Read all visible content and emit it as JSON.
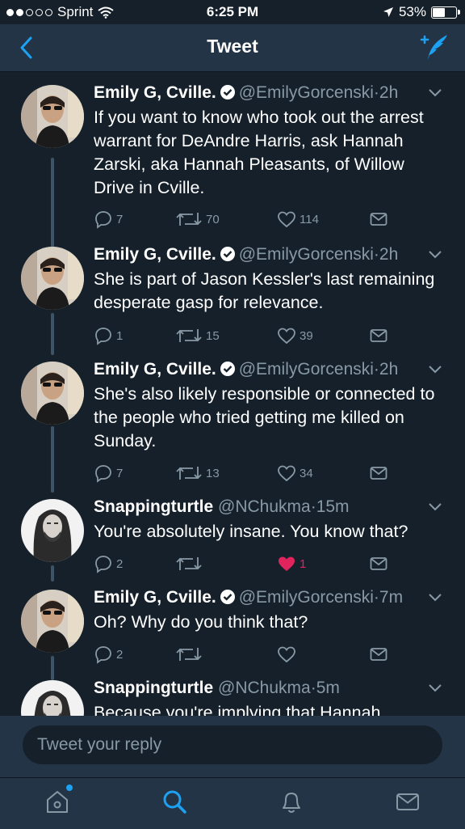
{
  "status_bar": {
    "carrier": "Sprint",
    "time": "6:25 PM",
    "battery": "53%"
  },
  "nav": {
    "title": "Tweet"
  },
  "tweets": [
    {
      "name": "Emily G, Cville.",
      "handle": "@EmilyGorcenski",
      "time": "2h",
      "text": "If you want to know who took out the arrest warrant for DeAndre Harris, ask Hannah Zarski, aka Hannah Pleasants, of Willow Drive in Cville.",
      "replies": "7",
      "retweets": "70",
      "likes": "114"
    },
    {
      "name": "Emily G, Cville.",
      "handle": "@EmilyGorcenski",
      "time": "2h",
      "text": "She is part of Jason Kessler's last remaining desperate gasp for relevance.",
      "replies": "1",
      "retweets": "15",
      "likes": "39"
    },
    {
      "name": "Emily G, Cville.",
      "handle": "@EmilyGorcenski",
      "time": "2h",
      "text": "She's also likely responsible or connected to the people who tried getting me killed on Sunday.",
      "replies": "7",
      "retweets": "13",
      "likes": "34"
    },
    {
      "name": "Snappingturtle",
      "handle": "@NChukma",
      "time": "15m",
      "text": "You're absolutely insane.  You know that?",
      "replies": "2",
      "retweets": "",
      "likes": "1"
    },
    {
      "name": "Emily G, Cville.",
      "handle": "@EmilyGorcenski",
      "time": "7m",
      "text": "Oh? Why do you think that?",
      "replies": "2",
      "retweets": "",
      "likes": ""
    },
    {
      "name": "Snappingturtle",
      "handle": "@NChukma",
      "time": "5m",
      "text": "Because you're implying that Hannah",
      "replies": "",
      "retweets": "",
      "likes": ""
    }
  ],
  "reply": {
    "placeholder": "Tweet your reply"
  },
  "colors": {
    "background": "#15202b",
    "bar": "#243447",
    "accent": "#1da1f2",
    "secondary": "#8899a6",
    "like": "#e0245e"
  },
  "icons": [
    "back-icon",
    "compose-tweet-icon",
    "verified-icon",
    "caret-down-icon",
    "reply-icon",
    "retweet-icon",
    "like-icon",
    "dm-icon",
    "home-icon",
    "search-icon",
    "notifications-icon",
    "messages-icon"
  ]
}
